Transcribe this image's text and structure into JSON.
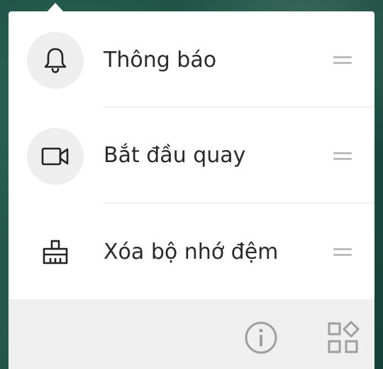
{
  "quick_settings": {
    "items": [
      {
        "label": "Thông báo",
        "icon": "bell-icon"
      },
      {
        "label": "Bắt đầu quay",
        "icon": "video-camera-icon"
      },
      {
        "label": "Xóa bộ nhớ đệm",
        "icon": "broom-icon"
      }
    ],
    "footer": {
      "info_icon": "info-icon",
      "edit_icon": "grid-shapes-icon"
    }
  }
}
